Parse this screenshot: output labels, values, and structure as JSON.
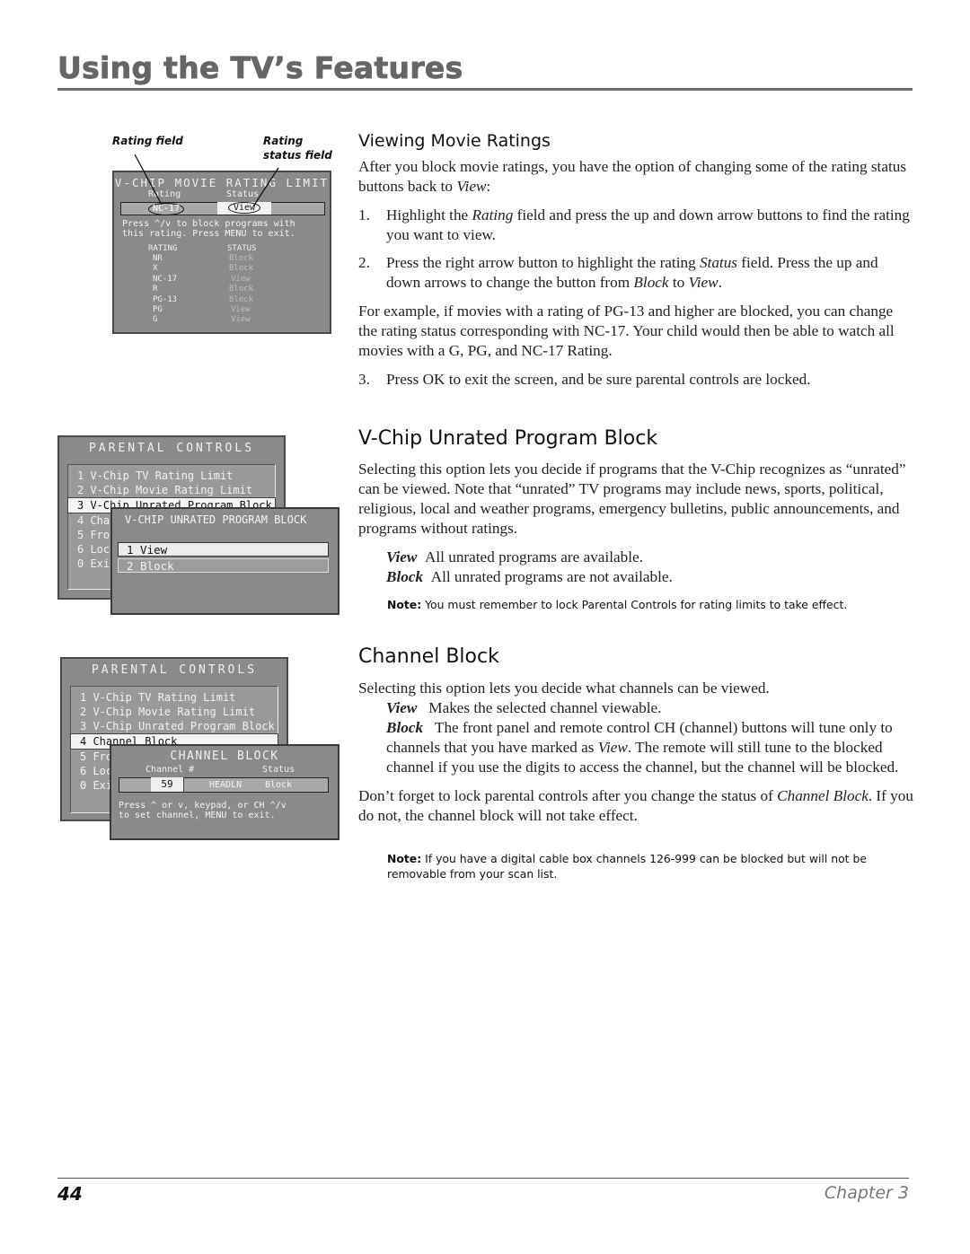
{
  "header": {
    "title": "Using the TV’s Features"
  },
  "footer": {
    "page_number": "44",
    "chapter": "Chapter 3"
  },
  "figure1": {
    "callout_left": "Rating field",
    "callout_right_line1": "Rating",
    "callout_right_line2": "status field",
    "title": "V-CHIP MOVIE RATING LIMIT",
    "col_rating": "Rating",
    "col_status": "Status",
    "current_rating": "NC-17",
    "current_status": "View",
    "instructions_line1": "Press ^/v to block programs with",
    "instructions_line2": "this rating. Press MENU to exit.",
    "table_header_rating": "RATING",
    "table_header_status": "STATUS",
    "rows": [
      {
        "rating": "NR",
        "status": "Block"
      },
      {
        "rating": "X",
        "status": "Block"
      },
      {
        "rating": "NC-17",
        "status": "View"
      },
      {
        "rating": "R",
        "status": "Block"
      },
      {
        "rating": "PG-13",
        "status": "Block"
      },
      {
        "rating": "PG",
        "status": "View"
      },
      {
        "rating": "G",
        "status": "View"
      }
    ]
  },
  "figure2": {
    "title": "PARENTAL CONTROLS",
    "items": [
      "1 V-Chip TV Rating Limit",
      "2 V-Chip Movie Rating Limit",
      "3 V-Chip Unrated Program Block",
      "4 Cha",
      "5 Fro",
      "6 Loc",
      "0 Exi"
    ],
    "selected_index": 2,
    "submenu_title": "V-CHIP UNRATED PROGRAM BLOCK",
    "submenu_options": [
      "1 View",
      "2 Block"
    ]
  },
  "figure3": {
    "title": "PARENTAL CONTROLS",
    "items": [
      "1 V-Chip TV Rating Limit",
      "2 V-Chip Movie Rating Limit",
      "3 V-Chip Unrated Program Block",
      "4 Channel Block",
      "5 Fro",
      "6 Loc",
      "0 Exi"
    ],
    "selected_index": 3,
    "submenu_title": "CHANNEL BLOCK",
    "col_channel": "Channel #",
    "col_status": "Status",
    "channel_value": "59",
    "channel_name": "HEADLN",
    "channel_status": "Block",
    "instructions_line1": "Press ^ or v, keypad, or CH ^/v",
    "instructions_line2": "to set channel, MENU to exit."
  },
  "section1": {
    "heading": "Viewing Movie Ratings",
    "intro_pre": "After you block movie ratings, you have the option of changing some of the rating status buttons back to ",
    "intro_italic": "View",
    "intro_post": ":",
    "steps": [
      {
        "num": "1.",
        "pre": "Highlight the ",
        "italic": "Rating",
        "post": " field and press the up and down arrow buttons to find the rating you want to view."
      },
      {
        "num": "2.",
        "pre": "Press the right arrow button to highlight the rating ",
        "italic": "Status",
        "post": " field. Press the up and down arrows to change the button from ",
        "italic2": "Block",
        "mid2": "  to ",
        "italic3": "View",
        "post2": "."
      }
    ],
    "example": "For example, if movies with a rating of PG-13 and higher are blocked, you can change the rating status corresponding with NC-17. Your child would then be able to watch all movies with a G, PG, and NC-17 Rating.",
    "step3": {
      "num": "3.",
      "text": "Press OK to exit the screen, and be sure parental controls are locked."
    }
  },
  "section2": {
    "heading": "V-Chip Unrated Program Block",
    "body": "Selecting this option lets you decide if programs that the V-Chip recognizes as “unrated” can be viewed. Note that “unrated” TV  programs may include news, sports, political, religious, local and weather programs, emergency bulletins, public announcements, and programs without ratings.",
    "defs": [
      {
        "term": "View",
        "text": "All unrated programs are available."
      },
      {
        "term": "Block",
        "text": "All unrated programs are not available."
      }
    ],
    "note_label": "Note:",
    "note_text": " You must remember to lock Parental Controls for rating limits to take effect."
  },
  "section3": {
    "heading": "Channel Block",
    "intro": "Selecting this option lets you decide what channels can be viewed.",
    "def_view_term": "View",
    "def_view_text": "Makes the selected channel viewable.",
    "def_block_term": "Block",
    "def_block_pre": "The front panel and remote control CH (channel) buttons will tune only to channels that you have marked as ",
    "def_block_italic": "View",
    "def_block_post": ". The remote will still tune to the blocked channel if you use the digits to access the channel, but the channel will be blocked.",
    "reminder_pre": "Don’t forget to lock parental controls after you change the status of ",
    "reminder_italic": "Channel Block",
    "reminder_post": ". If you do not, the channel block will not take effect.",
    "note_label": "Note:",
    "note_text": " If you have a digital cable box channels 126-999 can be blocked but will not be removable from your scan list."
  }
}
